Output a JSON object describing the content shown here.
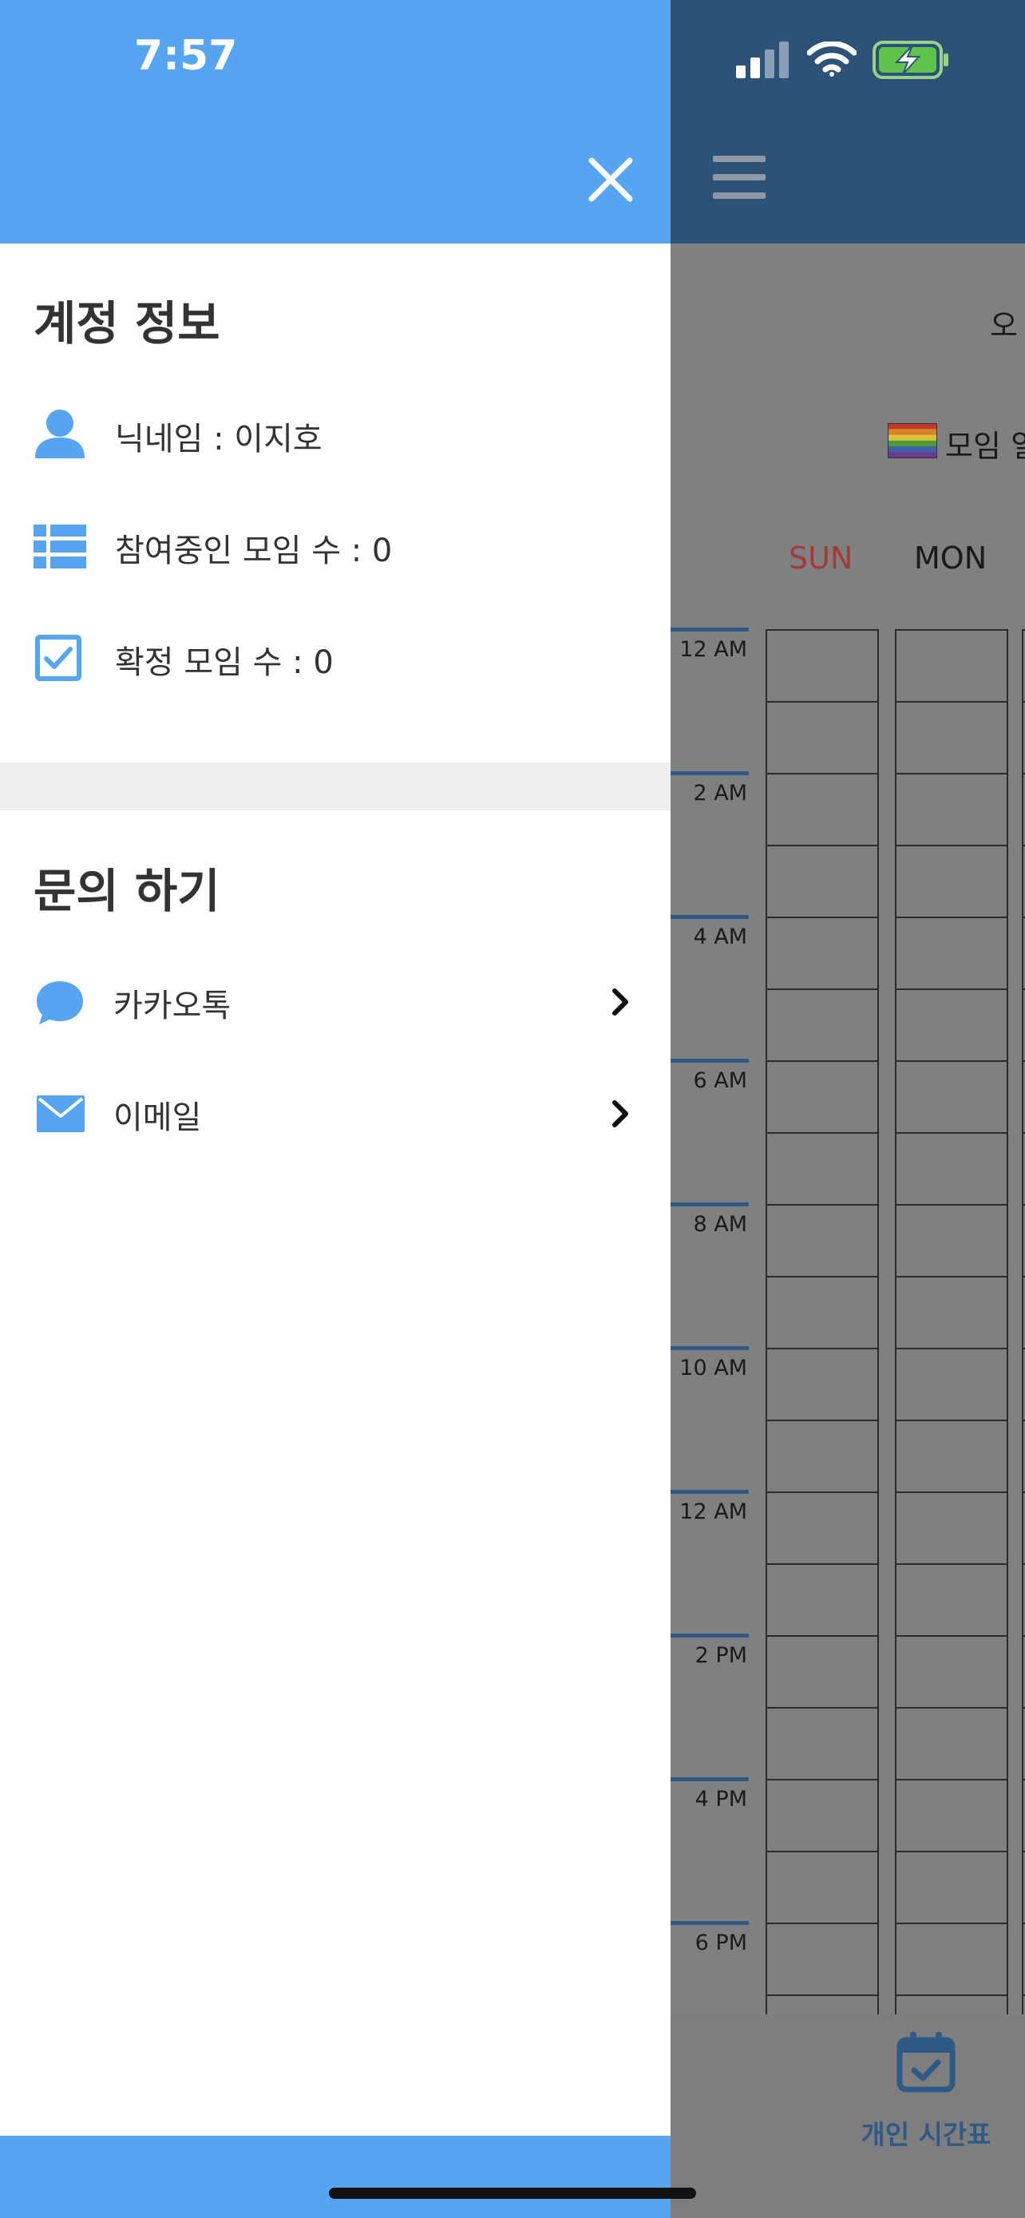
{
  "status_bar": {
    "time": "7:57"
  },
  "drawer": {
    "account_section": {
      "title": "계정 정보",
      "nickname": "닉네임 : 이지호",
      "joined_meetings": "참여중인 모임 수 : 0",
      "confirmed_meetings": "확정 모임 수 : 0"
    },
    "inquiry_section": {
      "title": "문의 하기",
      "kakaotalk": "카카오톡",
      "email": "이메일"
    },
    "colors": {
      "accent": "#55a5f1",
      "separator": "#efefef"
    }
  },
  "background": {
    "header_text": "오",
    "legend_label": "모임 일",
    "days": [
      "SUN",
      "MON"
    ],
    "times": [
      "12 AM",
      "2 AM",
      "4 AM",
      "6 AM",
      "8 AM",
      "10 AM",
      "12 AM",
      "2 PM",
      "4 PM",
      "6 PM"
    ],
    "tab_label": "개인 시간표",
    "colors": {
      "header": "#2c5278",
      "sunday": "#a33a3a",
      "tab": "#2f5a88"
    }
  }
}
